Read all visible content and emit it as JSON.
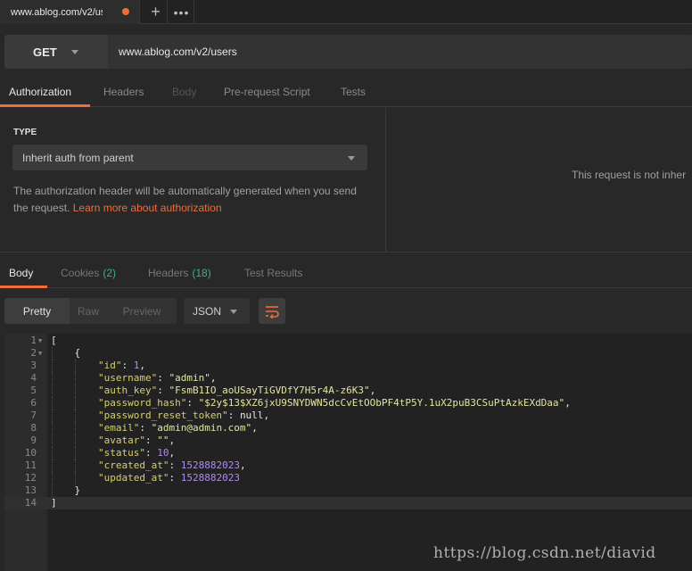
{
  "tab": {
    "title": "www.ablog.com/v2/us",
    "plus": "+",
    "more": "•••"
  },
  "request": {
    "method": "GET",
    "url": "www.ablog.com/v2/users"
  },
  "request_tabs": [
    "Authorization",
    "Headers",
    "Body",
    "Pre-request Script",
    "Tests"
  ],
  "auth": {
    "type_label": "TYPE",
    "type_value": "Inherit auth from parent",
    "help_text": "The authorization header will be automatically generated when you send the request.",
    "help_link": "Learn more about authorization",
    "right_text": "This request is not inher"
  },
  "response_tabs": {
    "body": "Body",
    "cookies": "Cookies",
    "cookies_count": "(2)",
    "headers": "Headers",
    "headers_count": "(18)",
    "test_results": "Test Results"
  },
  "view": {
    "pretty": "Pretty",
    "raw": "Raw",
    "preview": "Preview",
    "format": "JSON"
  },
  "code_lines": [
    {
      "n": "1",
      "text": "["
    },
    {
      "n": "2",
      "text": "    {"
    },
    {
      "n": "3",
      "key": "\"id\"",
      "val": "1",
      "vtype": "num"
    },
    {
      "n": "4",
      "key": "\"username\"",
      "val": "\"admin\"",
      "vtype": "str"
    },
    {
      "n": "5",
      "key": "\"auth_key\"",
      "val": "\"FsmB1IO_aoUSayTiGVDfY7H5r4A-z6K3\"",
      "vtype": "str"
    },
    {
      "n": "6",
      "key": "\"password_hash\"",
      "val": "\"$2y$13$XZ6jxU9SNYDWN5dcCvEtOObPF4tP5Y.1uX2puB3CSuPtAzkEXdDaa\"",
      "vtype": "str"
    },
    {
      "n": "7",
      "key": "\"password_reset_token\"",
      "val": "null",
      "vtype": "null"
    },
    {
      "n": "8",
      "key": "\"email\"",
      "val": "\"admin@admin.com\"",
      "vtype": "str"
    },
    {
      "n": "9",
      "key": "\"avatar\"",
      "val": "\"\"",
      "vtype": "str"
    },
    {
      "n": "10",
      "key": "\"status\"",
      "val": "10",
      "vtype": "num"
    },
    {
      "n": "11",
      "key": "\"created_at\"",
      "val": "1528882023",
      "vtype": "num"
    },
    {
      "n": "12",
      "key": "\"updated_at\"",
      "val": "1528882023",
      "vtype": "num"
    },
    {
      "n": "13",
      "text": "    }"
    },
    {
      "n": "14",
      "text": "]"
    }
  ],
  "watermark": "https://blog.csdn.net/diavid",
  "colors": {
    "accent": "#f26b3a",
    "count_green": "#3fb37f",
    "number_purple": "#ab8eea"
  }
}
